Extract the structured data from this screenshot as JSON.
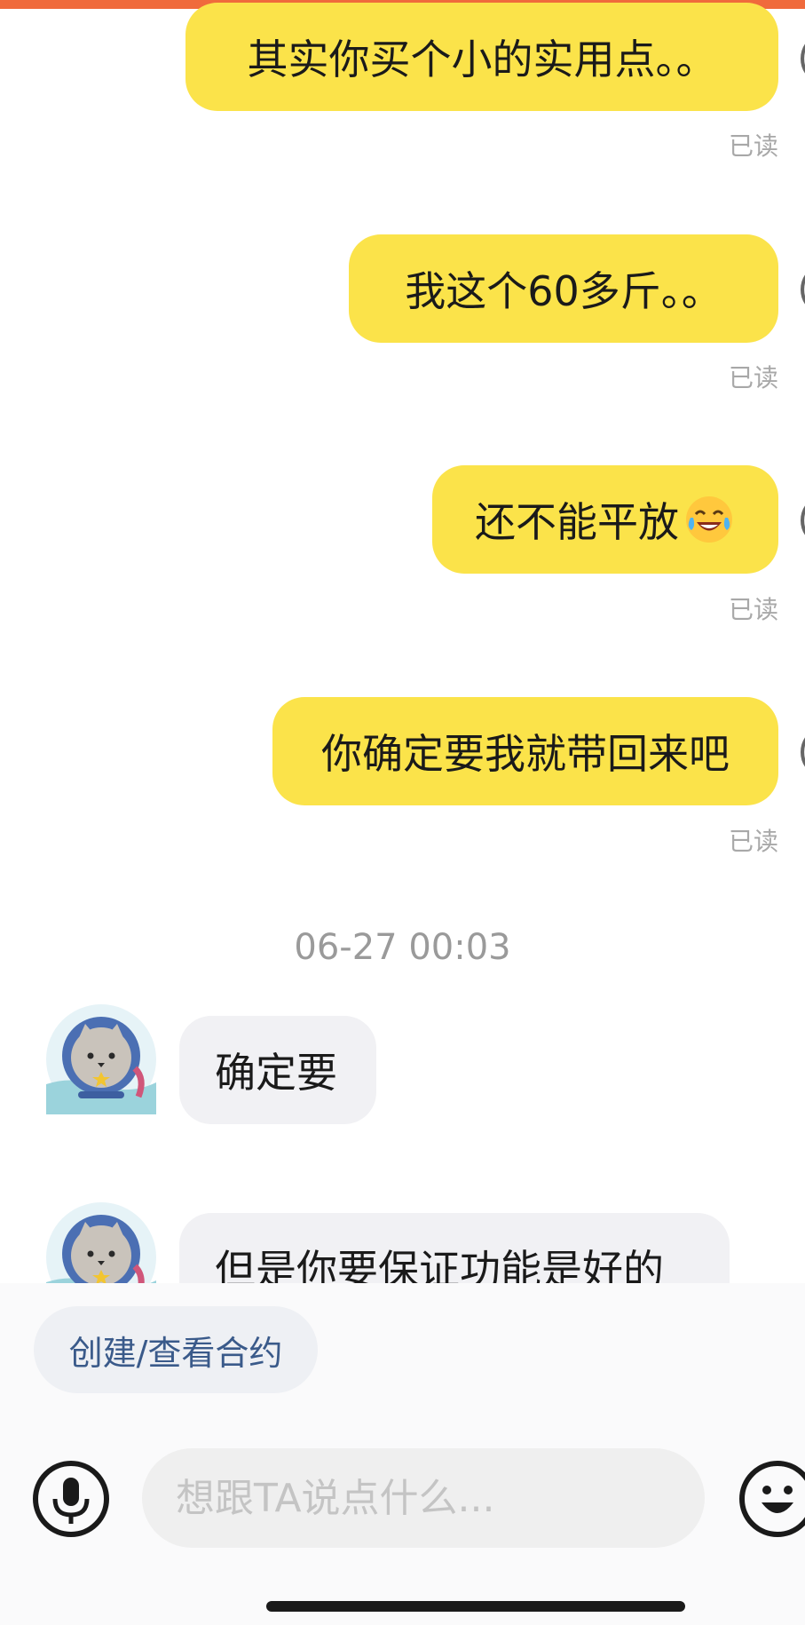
{
  "colors": {
    "outgoing_bubble": "#fbe34a",
    "incoming_bubble": "#f1f1f4",
    "top_bar": "#f06a3c",
    "chip_text": "#3a5a8a"
  },
  "messages": [
    {
      "direction": "out",
      "text": "其实你买个小的实用点。。",
      "status": "已读"
    },
    {
      "direction": "out",
      "text": "我这个60多斤。。",
      "status": "已读"
    },
    {
      "direction": "out",
      "text": "还不能平放",
      "emoji": "tears-of-joy-emoji",
      "status": "已读"
    },
    {
      "direction": "out",
      "text": "你确定要我就带回来吧",
      "status": "已读"
    },
    {
      "direction": "in",
      "text": "确定要"
    },
    {
      "direction": "in",
      "text": "但是你要保证功能是好的"
    }
  ],
  "timestamp": "06-27 00:03",
  "bottom": {
    "contract_button": "创建/查看合约",
    "input_placeholder": "想跟TA说点什么...",
    "icons": [
      "microphone-icon",
      "emoji-icon"
    ]
  }
}
